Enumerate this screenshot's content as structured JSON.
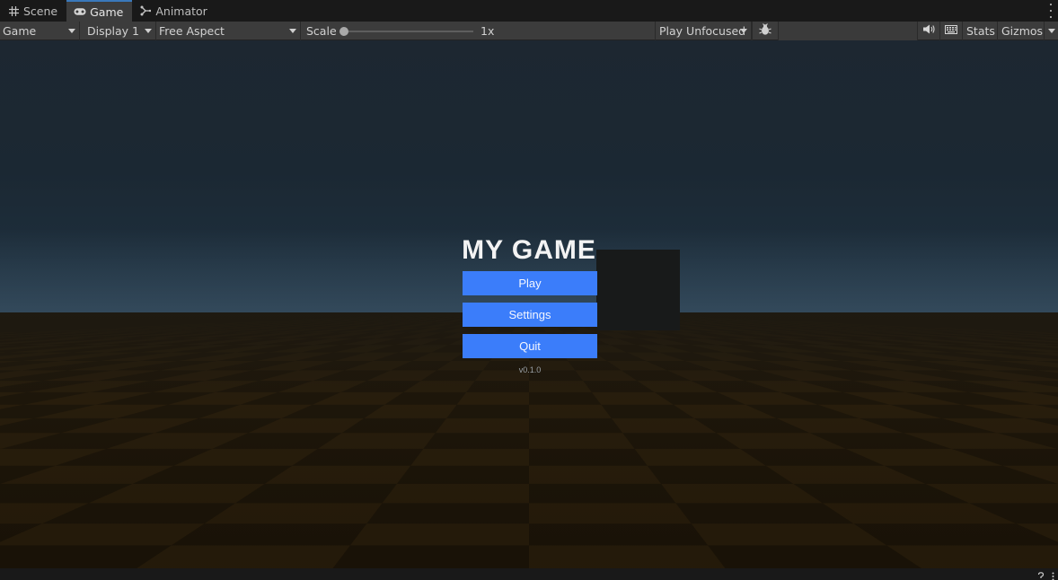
{
  "tabs": [
    {
      "label": "Scene",
      "icon": "grid-icon",
      "active": false
    },
    {
      "label": "Game",
      "icon": "gamepad-icon",
      "active": true
    },
    {
      "label": "Animator",
      "icon": "animator-icon",
      "active": false
    }
  ],
  "toolbar": {
    "view_mode": "Game",
    "display": "Display 1",
    "aspect": "Free Aspect",
    "scale_label": "Scale",
    "scale_value": "1x",
    "play_mode": "Play Unfocused",
    "stats_label": "Stats",
    "gizmos_label": "Gizmos"
  },
  "game": {
    "title": "MY GAME",
    "buttons": [
      {
        "label": "Play"
      },
      {
        "label": "Settings"
      },
      {
        "label": "Quit"
      }
    ],
    "version": "v0.1.0"
  },
  "colors": {
    "accent": "#3a79bb",
    "menu_button": "#3b7dfa",
    "toolbar_bg": "#3c3c3c",
    "floor_dark": "#1d1508",
    "floor_light": "#2a1e0b"
  }
}
